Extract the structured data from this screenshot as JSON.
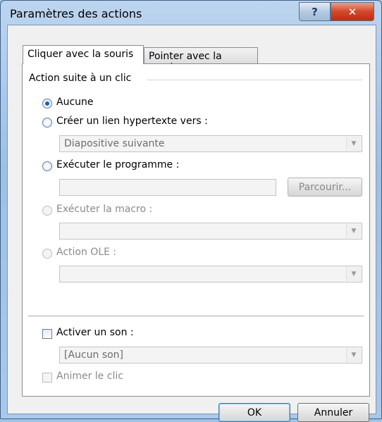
{
  "window": {
    "title": "Paramètres des actions",
    "help_glyph": "?",
    "close_glyph": "✕"
  },
  "tabs": [
    {
      "label": "Cliquer avec la souris",
      "active": true
    },
    {
      "label": "Pointer avec la souris",
      "active": false
    }
  ],
  "group": {
    "label": "Action suite à un clic"
  },
  "options": {
    "none": {
      "label": "Aucune",
      "checked": true
    },
    "hyperlink": {
      "label": "Créer un lien hypertexte vers :",
      "value": "Diapositive suivante"
    },
    "program": {
      "label": "Exécuter le programme :",
      "value": "",
      "browse": "Parcourir..."
    },
    "macro": {
      "label": "Exécuter la macro :",
      "value": ""
    },
    "ole": {
      "label": "Action OLE :",
      "value": ""
    }
  },
  "sound": {
    "label": "Activer un son :",
    "value": "[Aucun son]",
    "checked": false
  },
  "highlight": {
    "label": "Animer le clic",
    "checked": false
  },
  "buttons": {
    "ok": "OK",
    "cancel": "Annuler"
  },
  "icons": {
    "dropdown": "▼"
  },
  "colors": {
    "title_bar": "#a9c9ea",
    "close_button": "#c02d10",
    "radio_dot": "#1a5fb4"
  }
}
